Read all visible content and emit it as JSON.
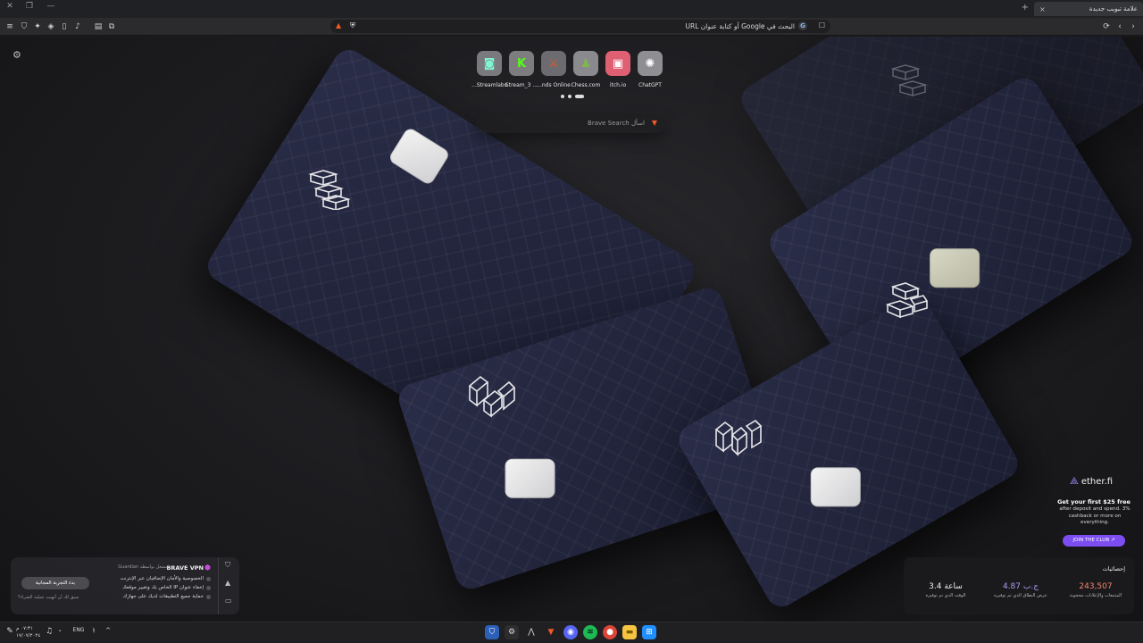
{
  "tab": {
    "title": "علامة تبويب جديدة",
    "close": "×",
    "new": "+"
  },
  "window": {
    "close": "✕",
    "restore": "❐",
    "minimize": "—"
  },
  "toolbar": {
    "reload": "⟳",
    "back": "‹",
    "forward": "›",
    "menu": "≡",
    "shield": "⛉",
    "puzzle": "✦",
    "wallet": "◈",
    "sidebar": "▯",
    "music": "♪",
    "screenshot": "⧉",
    "reader": "▤"
  },
  "address_bar": {
    "placeholder": "البحث في Google أو كتابة عنوان URL",
    "engine_icon": "G",
    "bookmark_icon": "☐",
    "brave_icon": "▲",
    "shield_icon": "⛨"
  },
  "new_tab": {
    "settings_icon": "⚙",
    "tiles": [
      {
        "label": "ChatGPT",
        "glyph": "✺",
        "bg": "#8e8e93",
        "fg": "#ffffff"
      },
      {
        "label": "itch.io",
        "glyph": "▣",
        "bg": "#e06073",
        "fg": "#fa5c5c"
      },
      {
        "label": "Chess.com",
        "glyph": "♟",
        "bg": "#8a8a8e",
        "fg": "#81b64c"
      },
      {
        "label": "...nds Online",
        "glyph": "⚔",
        "bg": "#6c6c70",
        "fg": "#e3572b"
      },
      {
        "label": "Stream_3 ...",
        "glyph": "K",
        "bg": "#7d7d80",
        "fg": "#53fc18"
      },
      {
        "label": "...Streamlabs",
        "glyph": "◙",
        "bg": "#7a7a7e",
        "fg": "#80f5d2"
      }
    ],
    "search": {
      "placeholder": "اسأل Brave Search",
      "icon": "▼"
    }
  },
  "vpn_widget": {
    "title": "BRAVE VPN",
    "subtitle": "مشغل بواسطة Guardian",
    "features": [
      "الخصوصية والأمان الإضافيان عبر الإنترنت",
      "إخفاء عنوان IP الخاص بك وتغيير موقعك",
      "حماية جميع التطبيقات لديك على جهازك"
    ],
    "cta": "بدء التجربة المجانية",
    "note": "سبق لك أن أنهيت عملية الشراء؟"
  },
  "ad": {
    "brand": "ether.fi",
    "headline": "Get your first $25 free",
    "body": "after deposit and spend. 3% cashback or more on everything.",
    "button": "JOIN THE CLUB ↗"
  },
  "stats": {
    "title": "إحصائيات",
    "items": [
      {
        "value": "243,507",
        "label": "المتتبعات والإعلانات محجوبة",
        "color": "#f5826c"
      },
      {
        "value": "4.87 ج.ب",
        "label": "عرض النطاق الذي تم توفيره",
        "color": "#a79cf5"
      },
      {
        "value": "3.4 ساعة",
        "label": "الوقت الذي تم توفيره",
        "color": "#f0f0f0"
      }
    ]
  },
  "taskbar": {
    "time": "٠٧:٣١ م",
    "date": "١٧/٠٧/٢٠٢٤",
    "lang": "ENG",
    "apps": [
      "shield",
      "settings",
      "vector",
      "brave",
      "discord",
      "spotify",
      "chrome",
      "files",
      "start"
    ]
  }
}
